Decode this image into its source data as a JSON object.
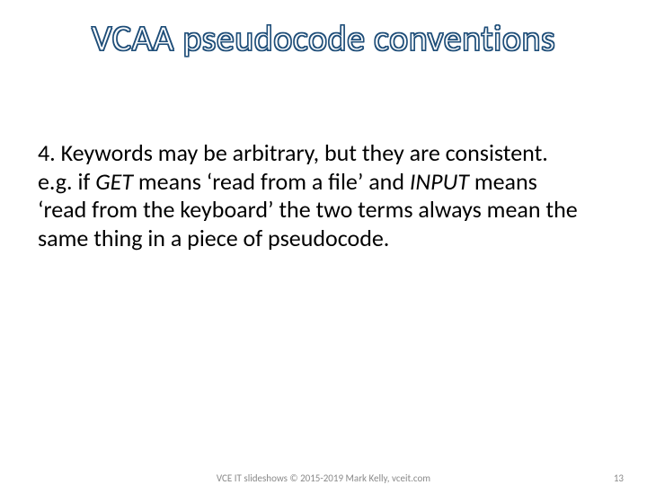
{
  "title": "VCAA pseudocode conventions",
  "body": {
    "line1": "4. Keywords may be arbitrary, but they are consistent.",
    "line2a": "e.g. if ",
    "line2b_italic": "GET",
    "line2c": " means ‘read from a file’ and ",
    "line2d_italic": "INPUT",
    "line2e": " means ‘read from the keyboard’ the two terms always mean the same thing in a piece of pseudocode."
  },
  "footer": {
    "center": "VCE IT slideshows © 2015-2019 Mark Kelly, vceit.com",
    "page": "13"
  }
}
